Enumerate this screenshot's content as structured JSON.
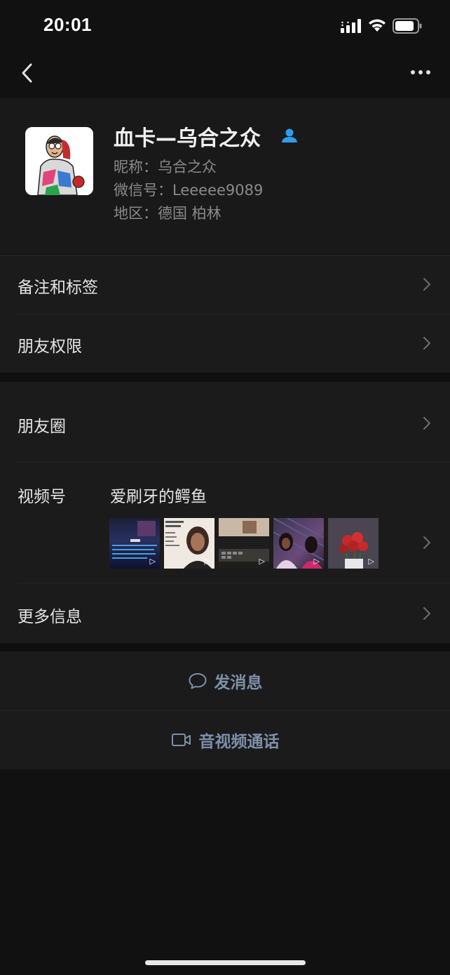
{
  "status_bar": {
    "time": "20:01"
  },
  "profile": {
    "display_name": "血卡—乌合之众",
    "nickname": "昵称：乌合之众",
    "wechat_id": "微信号：Leeeee9089",
    "region": "地区：德国 柏林"
  },
  "menu": {
    "remarks_tags": "备注和标签",
    "friend_permissions": "朋友权限",
    "moments": "朋友圈",
    "channels_label": "视频号",
    "channels_name": "爱刷牙的鳄鱼",
    "more_info": "更多信息"
  },
  "actions": {
    "send_message": "发消息",
    "av_call": "音视频通话"
  },
  "colors": {
    "background": "#111111",
    "row": "#1b1b1b",
    "action_text": "#7d90aa",
    "contact_badge": "#2f9bea"
  },
  "icons": [
    "back-icon",
    "more-icon",
    "contact-icon",
    "chevron-right-icon",
    "chat-bubble-icon",
    "video-camera-icon",
    "play-icon"
  ]
}
